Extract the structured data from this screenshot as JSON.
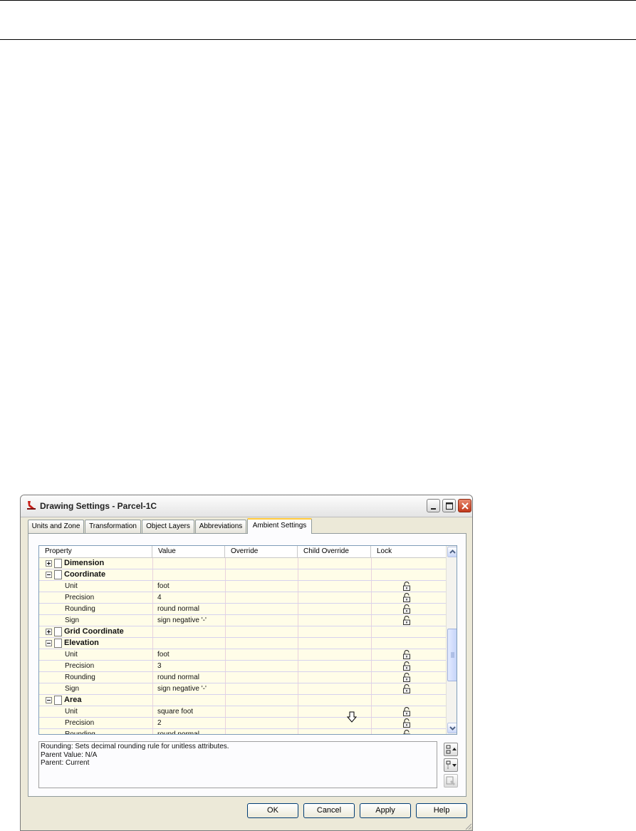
{
  "window": {
    "title": "Drawing Settings - Parcel-1C",
    "tabs": [
      {
        "label": "Units and Zone",
        "active": false
      },
      {
        "label": "Transformation",
        "active": false
      },
      {
        "label": "Object Layers",
        "active": false
      },
      {
        "label": "Abbreviations",
        "active": false
      },
      {
        "label": "Ambient Settings",
        "active": true
      }
    ]
  },
  "grid": {
    "columns": [
      "Property",
      "Value",
      "Override",
      "Child Override",
      "Lock"
    ],
    "rows": [
      {
        "type": "group",
        "expanded": false,
        "label": "Dimension"
      },
      {
        "type": "group",
        "expanded": true,
        "label": "Coordinate"
      },
      {
        "type": "item",
        "label": "Unit",
        "value": "foot",
        "lock": true
      },
      {
        "type": "item",
        "label": "Precision",
        "value": "4",
        "lock": true
      },
      {
        "type": "item",
        "label": "Rounding",
        "value": "round normal",
        "lock": true
      },
      {
        "type": "item",
        "label": "Sign",
        "value": "sign negative '-'",
        "lock": true
      },
      {
        "type": "group",
        "expanded": false,
        "label": "Grid Coordinate"
      },
      {
        "type": "group",
        "expanded": true,
        "label": "Elevation"
      },
      {
        "type": "item",
        "label": "Unit",
        "value": "foot",
        "lock": true
      },
      {
        "type": "item",
        "label": "Precision",
        "value": "3",
        "lock": true
      },
      {
        "type": "item",
        "label": "Rounding",
        "value": "round normal",
        "lock": true
      },
      {
        "type": "item",
        "label": "Sign",
        "value": "sign negative '-'",
        "lock": true
      },
      {
        "type": "group",
        "expanded": true,
        "label": "Area"
      },
      {
        "type": "item",
        "label": "Unit",
        "value": "square foot",
        "lock": true
      },
      {
        "type": "item",
        "label": "Precision",
        "value": "2",
        "lock": true
      },
      {
        "type": "item",
        "label": "Rounding",
        "value": "round normal",
        "lock": true
      }
    ]
  },
  "description": {
    "line1": "Rounding: Sets decimal rounding rule for unitless attributes.",
    "line2": "Parent Value: N/A",
    "line3": "Parent: Current"
  },
  "buttons": {
    "ok": "OK",
    "cancel": "Cancel",
    "apply": "Apply",
    "help": "Help"
  },
  "icons": {
    "app": "civil3d-app-icon",
    "minimize": "minimize-icon",
    "maximize": "maximize-icon",
    "close": "close-icon",
    "lock": "padlock-open-icon",
    "expand": "plus-box-icon",
    "collapse": "minus-box-icon",
    "cursor": "down-arrow-cursor-icon"
  },
  "colors": {
    "row_bg": "#fffde8",
    "tab_highlight": "#ffc83c",
    "close_button": "#c2391c"
  }
}
